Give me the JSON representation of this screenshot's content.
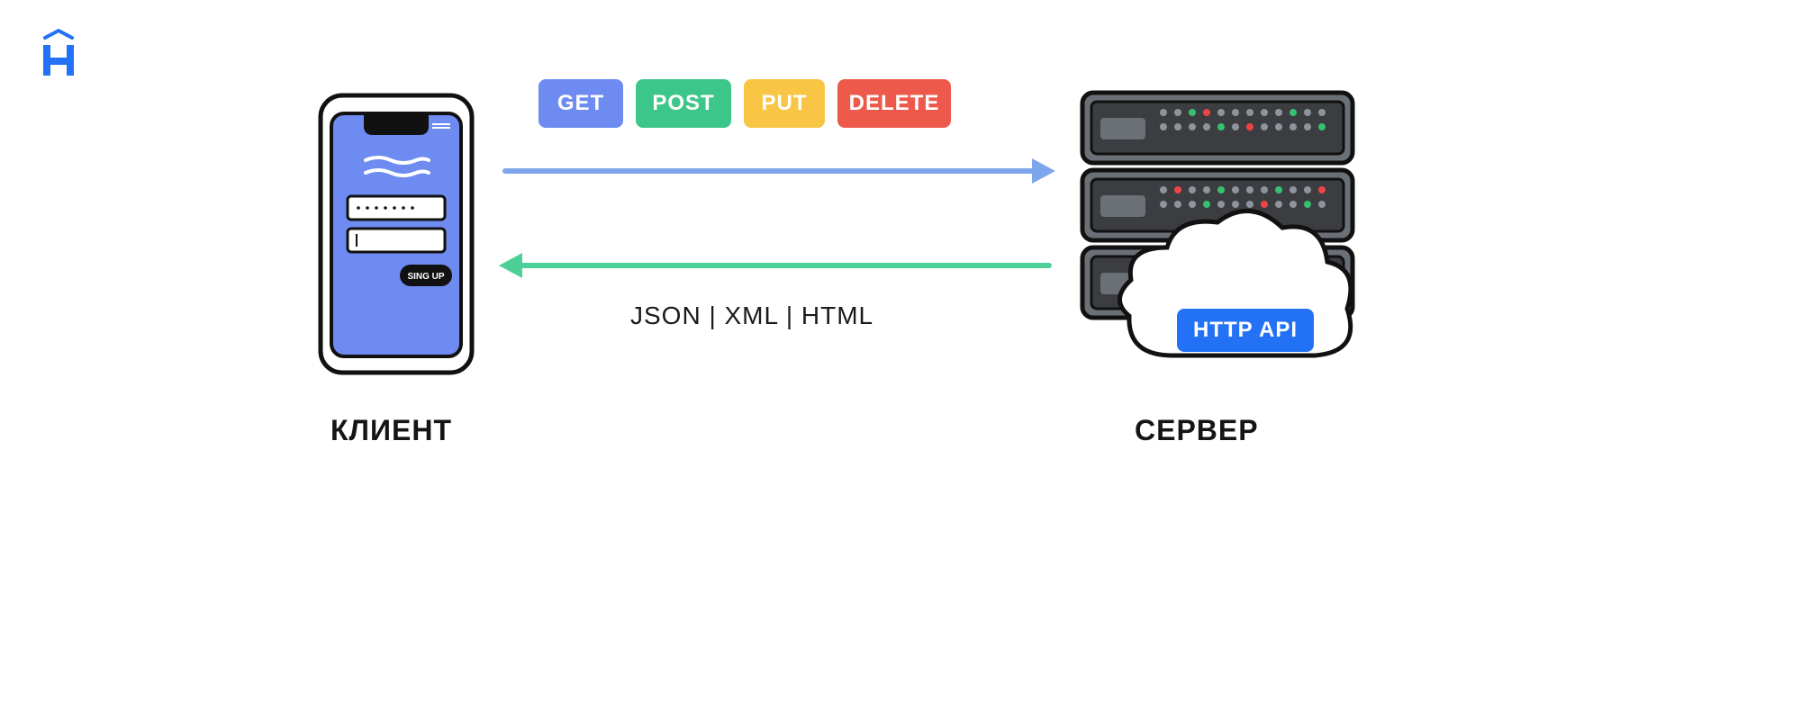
{
  "methods": {
    "get": "GET",
    "post": "POST",
    "put": "PUT",
    "delete": "DELETE"
  },
  "formats": "JSON | XML | HTML",
  "labels": {
    "client": "КЛИЕНТ",
    "server": "СЕРВЕР"
  },
  "http_api": "HTTP API",
  "phone": {
    "button": "SING UP"
  },
  "colors": {
    "method_get": "#6d8bf0",
    "method_post": "#3cc68a",
    "method_put": "#f8c544",
    "method_delete": "#ed5a4c",
    "arrow_request": "#7ea6ec",
    "arrow_response": "#4dcf98",
    "http_api_badge": "#2372f5",
    "phone_screen": "#6d8bf0"
  }
}
